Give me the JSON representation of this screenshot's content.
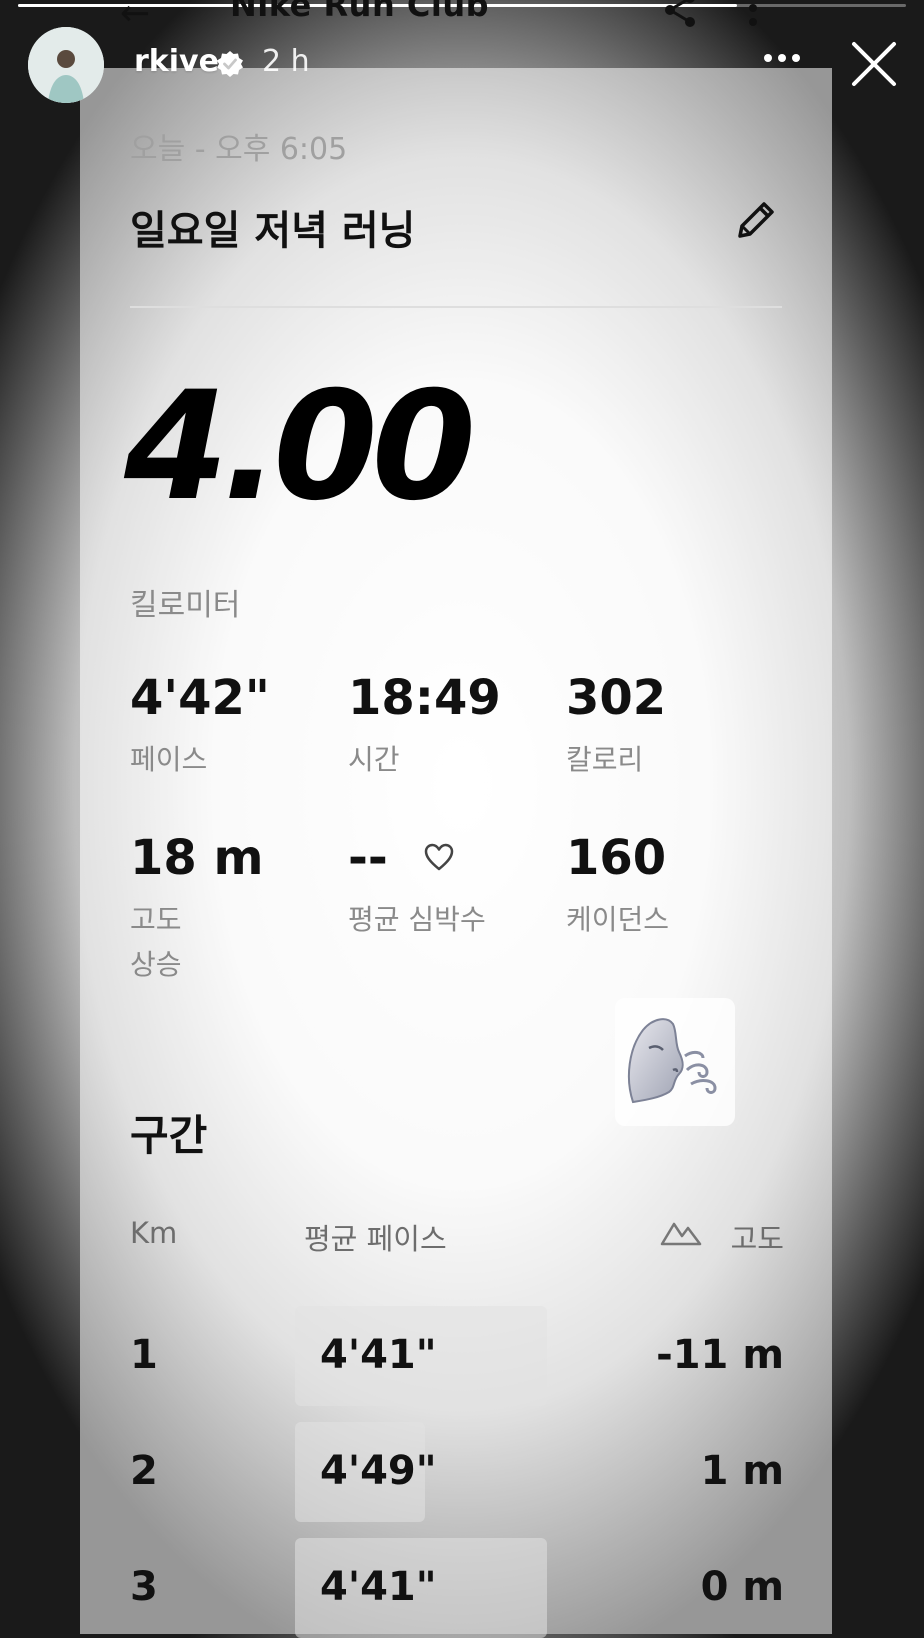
{
  "story": {
    "username": "rkive",
    "time": "2 h",
    "progress_fraction": 0.81
  },
  "app": {
    "title": "Nike Run Club"
  },
  "run": {
    "date": "오늘 - 오후 6:05",
    "title": "일요일 저녁 러닝",
    "distance": "4.00",
    "distance_unit": "킬로미터",
    "stats": [
      {
        "value": "4'42\"",
        "label": "페이스"
      },
      {
        "value": "18:49",
        "label": "시간"
      },
      {
        "value": "302",
        "label": "칼로리"
      },
      {
        "value": "18 m",
        "label": "고도\n상승"
      },
      {
        "value": "--",
        "label": "평균 심박수"
      },
      {
        "value": "160",
        "label": "케이던스"
      }
    ]
  },
  "splits": {
    "title": "구간",
    "col_km": "Km",
    "col_pace": "평균 페이스",
    "col_elev": "고도",
    "rows": [
      {
        "km": "1",
        "pace": "4'41\"",
        "elev": "-11 m",
        "pace_fraction": 0.97
      },
      {
        "km": "2",
        "pace": "4'49\"",
        "elev": "1 m",
        "pace_fraction": 0.5
      },
      {
        "km": "3",
        "pace": "4'41\"",
        "elev": "0 m",
        "pace_fraction": 0.97
      }
    ]
  },
  "icons": {
    "back": "arrow-left-icon",
    "share": "share-icon",
    "more": "more-vertical-icon",
    "story_more": "more-horizontal-icon",
    "close": "close-icon",
    "edit": "pencil-icon",
    "heart": "heart-icon",
    "elevation": "mountain-icon",
    "sticker": "face-exhaling-emoji"
  }
}
